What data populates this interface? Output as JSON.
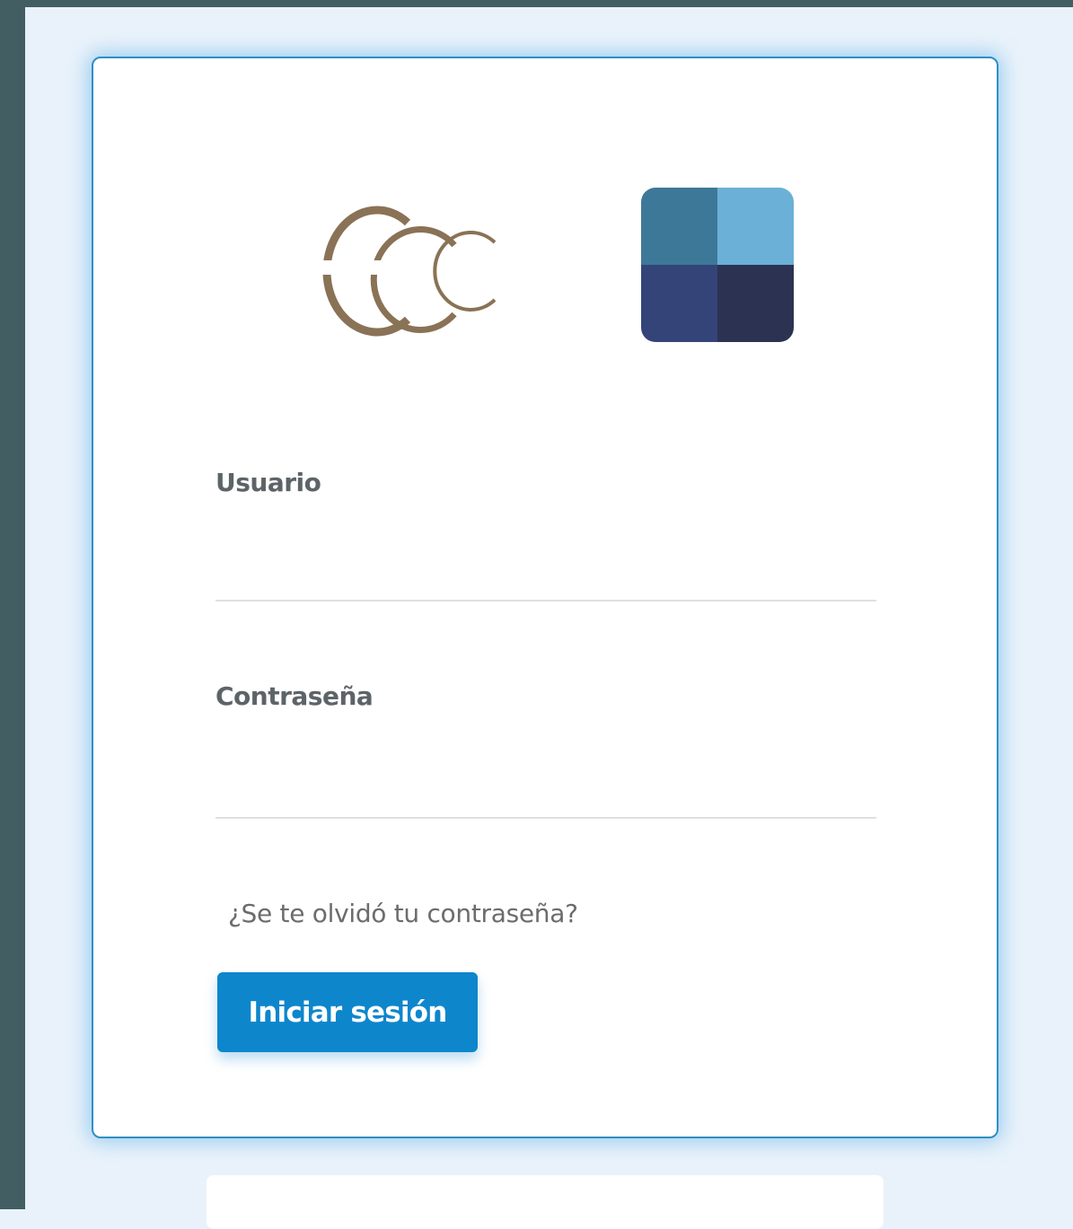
{
  "colors": {
    "frame": "#425e62",
    "page_background": "#e9f2fa",
    "card_border": "#2f8fc4",
    "primary": "#0e86cc",
    "logo_gold": "#8a7256",
    "logo_tiles": [
      "#3e7898",
      "#6bb0d6",
      "#344478",
      "#2c3352"
    ]
  },
  "logos": {
    "left_icon": "ccc-crescent-logo-icon",
    "right_icon": "four-square-tile-logo-icon"
  },
  "form": {
    "username": {
      "label": "Usuario",
      "value": "",
      "placeholder": ""
    },
    "password": {
      "label": "Contraseña",
      "value": "",
      "placeholder": ""
    },
    "forgot_password_link": "¿Se te olvidó tu contraseña?",
    "submit_label": "Iniciar sesión"
  }
}
